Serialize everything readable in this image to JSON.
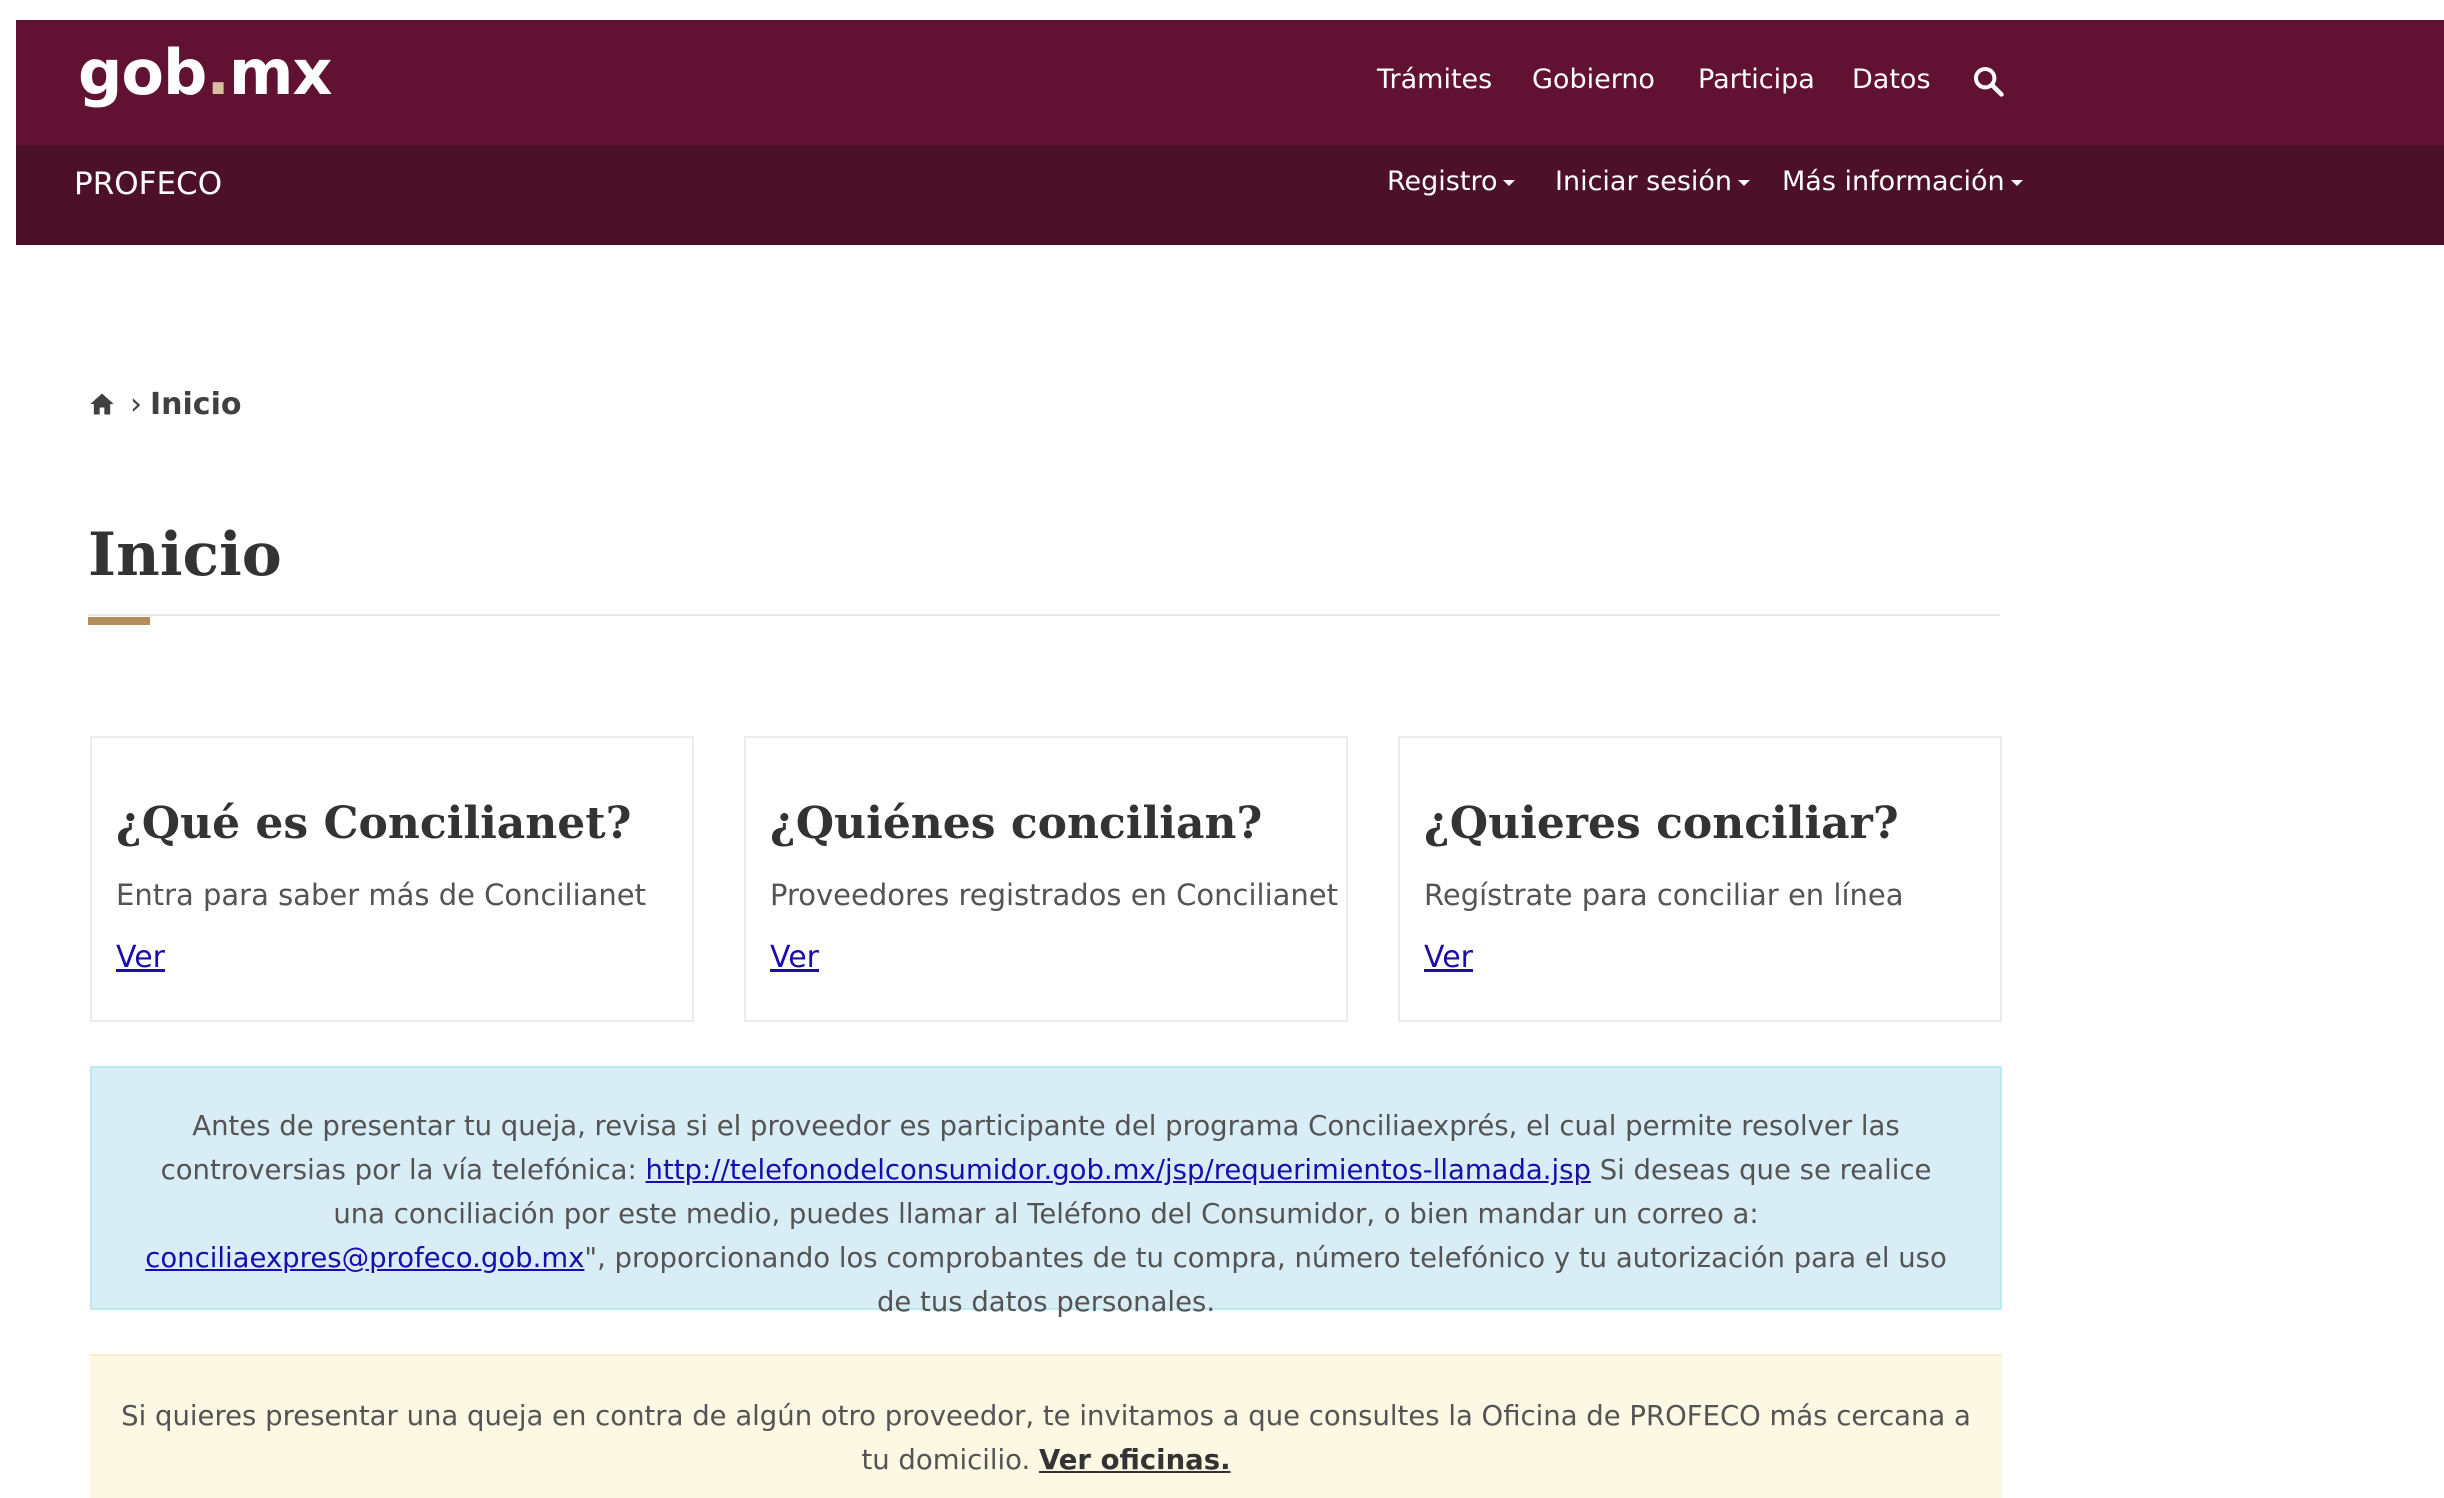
{
  "header": {
    "logo_main": "gob",
    "logo_dot": ".",
    "logo_tld": "mx",
    "nav": [
      "Trámites",
      "Gobierno",
      "Participa",
      "Datos"
    ],
    "search_icon": "search-icon",
    "entity": "PROFECO",
    "subnav": [
      "Registro",
      "Iniciar sesión",
      "Más información"
    ]
  },
  "breadcrumb": {
    "home_icon": "home-icon",
    "separator": "›",
    "current": "Inicio"
  },
  "page": {
    "title": "Inicio"
  },
  "cards": [
    {
      "title": "¿Qué es Concilianet?",
      "description": "Entra para saber más de Concilianet",
      "link": "Ver"
    },
    {
      "title": "¿Quiénes concilian?",
      "description": "Proveedores registrados en Concilianet",
      "link": "Ver"
    },
    {
      "title": "¿Quieres conciliar?",
      "description": "Regístrate para conciliar en línea",
      "link": "Ver"
    }
  ],
  "info_alert": {
    "text_1": "Antes de presentar tu queja, revisa si el proveedor es participante del programa Conciliaexprés, el cual permite resolver las controversias por la vía telefónica: ",
    "link_1": "http://telefonodelconsumidor.gob.mx/jsp/requerimientos-llamada.jsp",
    "text_2": " Si deseas que se realice una conciliación por este medio, puedes llamar al Teléfono del Consumidor, o bien mandar un correo a: ",
    "link_2": "conciliaexpres@profeco.gob.mx",
    "text_3": "\", proporcionando los comprobantes de tu compra, número telefónico y tu autorización para el uso de tus datos personales."
  },
  "warning_alert": {
    "text": "Si quieres presentar una queja en contra de algún otro proveedor, te invitamos a que consultes la Oficina de PROFECO más cercana a tu domicilio. ",
    "link": "Ver oficinas."
  },
  "colors": {
    "header_primary": "#611232",
    "header_secondary": "#4d1029",
    "accent_gold": "#b38e5d",
    "info_bg": "#d9edf7",
    "warning_bg": "#fcf8e3",
    "link": "#1a0dab"
  }
}
